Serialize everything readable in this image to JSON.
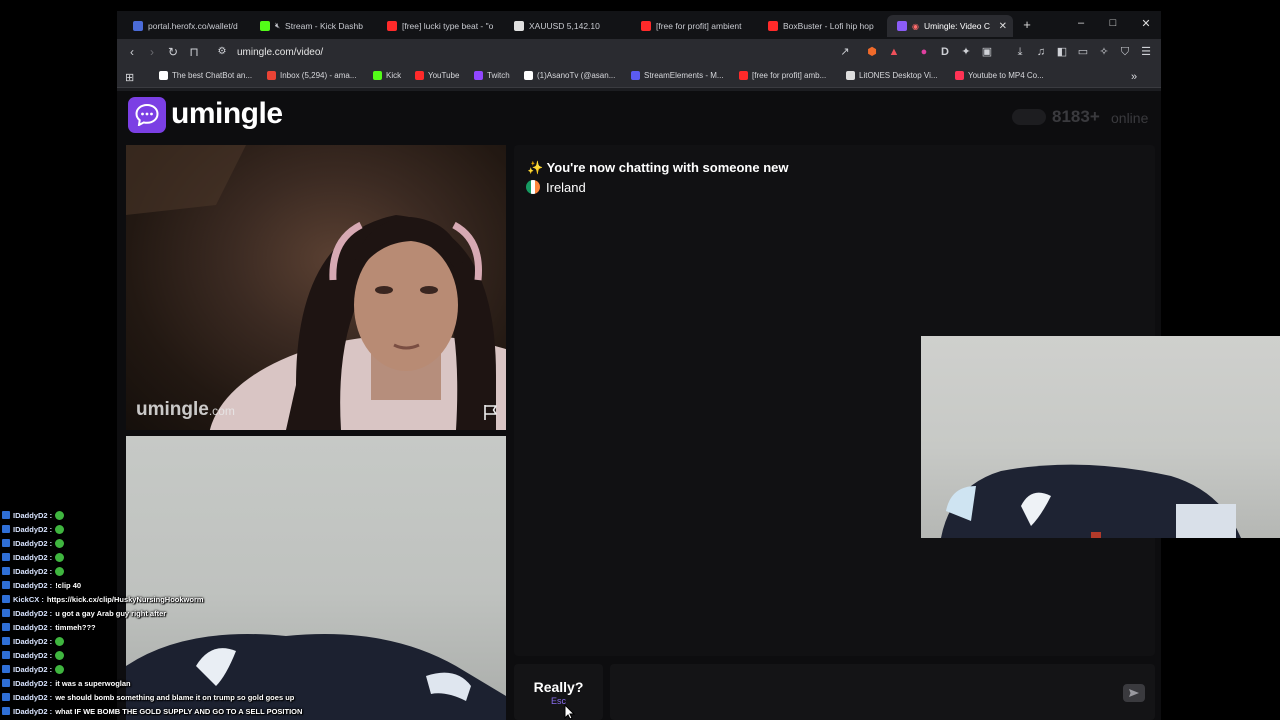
{
  "browser": {
    "tabs": [
      {
        "title": "portal.herofx.co/wallet/d",
        "favicon_color": "#4a6bd8",
        "active": false
      },
      {
        "title": "Stream - Kick Dashb",
        "favicon_color": "#53fc18",
        "active": false
      },
      {
        "title": "[free] lucki type beat - \"o",
        "favicon_color": "#ff2a2a",
        "active": false
      },
      {
        "title": "XAUUSD 5,142.10",
        "favicon_color": "#e0e0e0",
        "active": false
      },
      {
        "title": "[free for profit] ambient",
        "favicon_color": "#ff2a2a",
        "active": false
      },
      {
        "title": "BoxBuster - Lofi hip hop",
        "favicon_color": "#ff2a2a",
        "active": false
      },
      {
        "title": "Umingle: Video C",
        "favicon_color": "#8b5cf6",
        "active": true
      }
    ],
    "new_tab_label": "+",
    "window_controls": {
      "minimize": "–",
      "maximize": "□",
      "close": "✕"
    },
    "url": "umingle.com/video/",
    "bookmarks": [
      {
        "label": "The best ChatBot an...",
        "favicon_color": "#ffffff"
      },
      {
        "label": "Inbox (5,294) - ama...",
        "favicon_color": "#ea4335"
      },
      {
        "label": "Kick",
        "favicon_color": "#53fc18"
      },
      {
        "label": "YouTube",
        "favicon_color": "#ff2a2a"
      },
      {
        "label": "Twitch",
        "favicon_color": "#9146ff"
      },
      {
        "label": "(1)AsanoTv (@asan...",
        "favicon_color": "#ffffff"
      },
      {
        "label": "StreamElements - M...",
        "favicon_color": "#5b5bf0"
      },
      {
        "label": "[free for profit] amb...",
        "favicon_color": "#ff2a2a"
      },
      {
        "label": "LitONES Desktop Vi...",
        "favicon_color": "#dddddd"
      },
      {
        "label": "Youtube to MP4 Co...",
        "favicon_color": "#ff3355"
      }
    ],
    "bookmarks_more": "»"
  },
  "page": {
    "logo_text": "umingle",
    "online_count": "8183+",
    "online_label": "online",
    "watermark": "umingle",
    "watermark_domain": ".com",
    "chat_intro": "✨ You're now chatting with someone new",
    "country": "Ireland",
    "skip_label": "Really?",
    "skip_hint": "Esc",
    "message_placeholder": ""
  },
  "stream_chat": [
    {
      "user": "IDaddyD2",
      "message": "",
      "emote": true
    },
    {
      "user": "IDaddyD2",
      "message": "",
      "emote": true
    },
    {
      "user": "IDaddyD2",
      "message": "",
      "emote": true
    },
    {
      "user": "IDaddyD2",
      "message": "",
      "emote": true
    },
    {
      "user": "IDaddyD2",
      "message": "",
      "emote": true
    },
    {
      "user": "IDaddyD2",
      "message": "!clip 40",
      "emote": false
    },
    {
      "user": "KickCX",
      "message": "https://kick.cx/clip/HuskyNursingHookworm",
      "emote": false
    },
    {
      "user": "IDaddyD2",
      "message": "u got a gay Arab guy right after",
      "emote": false
    },
    {
      "user": "IDaddyD2",
      "message": "timmeh???",
      "emote": false
    },
    {
      "user": "IDaddyD2",
      "message": "",
      "emote": true
    },
    {
      "user": "IDaddyD2",
      "message": "",
      "emote": true
    },
    {
      "user": "IDaddyD2",
      "message": "",
      "emote": true
    },
    {
      "user": "IDaddyD2",
      "message": "it was a superwoglan",
      "emote": false
    },
    {
      "user": "IDaddyD2",
      "message": "we should bomb something and blame it on trump so gold goes up",
      "emote": false
    },
    {
      "user": "IDaddyD2",
      "message": "what IF WE BOMB THE GOLD SUPPLY AND GO TO A SELL POSITION",
      "emote": false
    }
  ],
  "colors": {
    "brand": "#7b3fe4",
    "accent_hint": "#8a6ef0",
    "page_bg": "#0d0d0f"
  }
}
